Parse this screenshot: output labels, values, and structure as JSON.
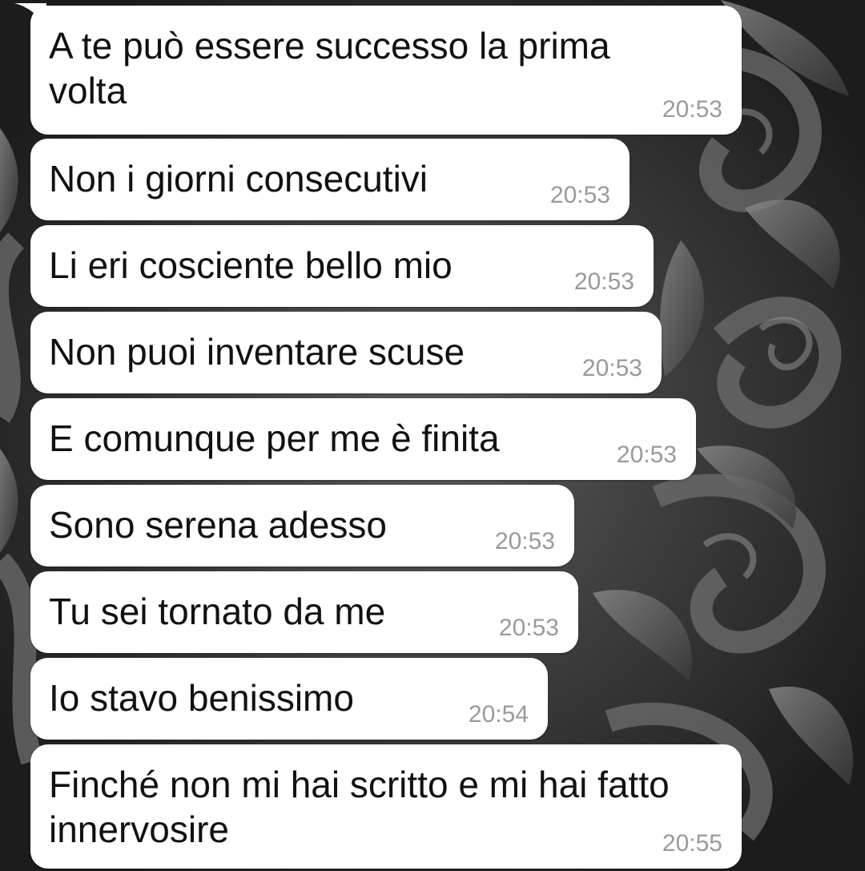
{
  "chat": {
    "messages": [
      {
        "text": "A te può essere successo la prima\nvolta",
        "time": "20:53"
      },
      {
        "text": "Non i giorni consecutivi",
        "time": "20:53"
      },
      {
        "text": "Li eri cosciente bello mio",
        "time": "20:53"
      },
      {
        "text": "Non puoi inventare scuse",
        "time": "20:53"
      },
      {
        "text": "E comunque per me è finita",
        "time": "20:53"
      },
      {
        "text": "Sono serena adesso",
        "time": "20:53"
      },
      {
        "text": "Tu sei tornato da me",
        "time": "20:53"
      },
      {
        "text": "Io stavo benissimo",
        "time": "20:54"
      },
      {
        "text": "Finché non mi hai scritto e mi hai fatto\ninnervosire",
        "time": "20:55"
      }
    ]
  },
  "colors": {
    "bubble": "#ffffff",
    "text": "#111111",
    "timestamp": "#9a9a9a",
    "wallpaper": "#2f2f2f"
  },
  "wallpaper": {
    "icon": "ornamental-swirl-pattern"
  }
}
